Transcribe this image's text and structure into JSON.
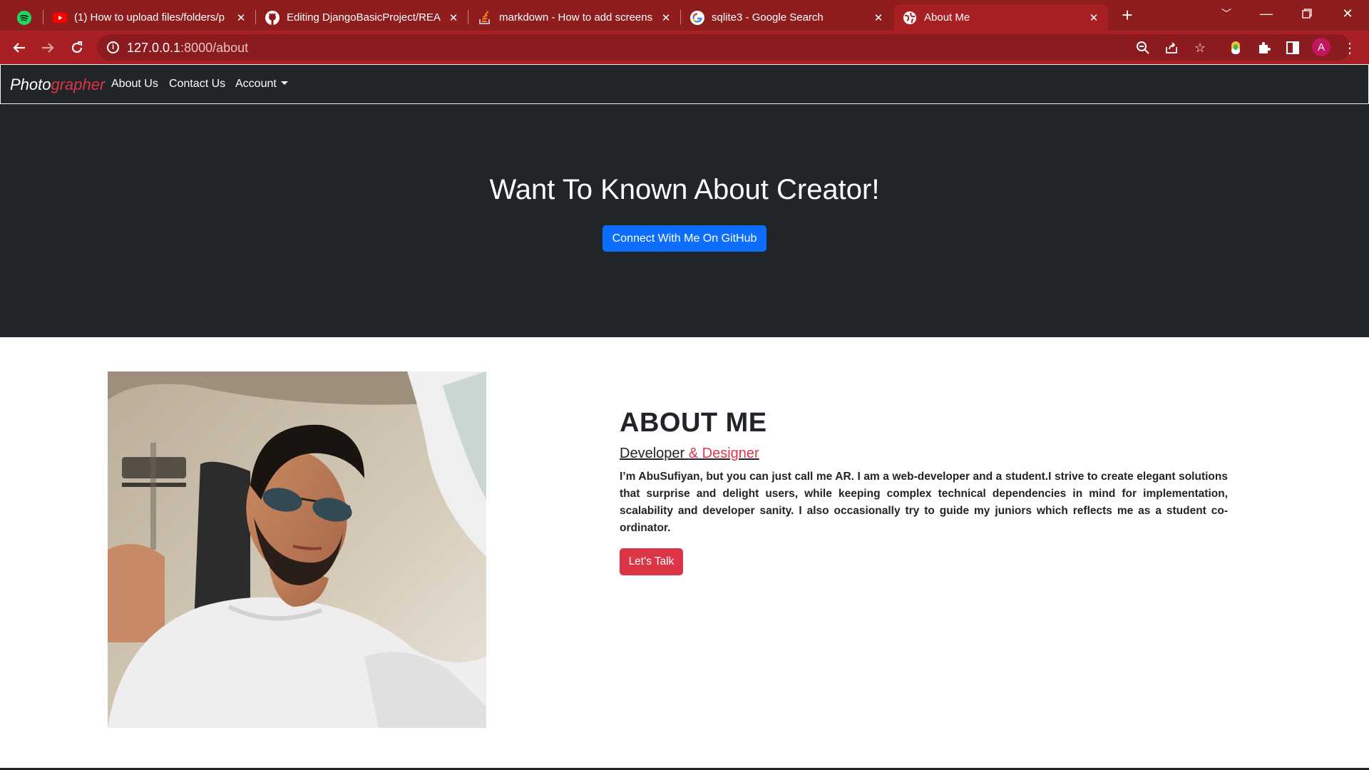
{
  "browser": {
    "tabs": [
      {
        "title": "",
        "icon": "spotify-icon"
      },
      {
        "title": "(1) How to upload files/folders/p",
        "icon": "youtube-icon"
      },
      {
        "title": "Editing DjangoBasicProject/READ",
        "icon": "github-icon"
      },
      {
        "title": "markdown - How to add screensl",
        "icon": "stackoverflow-icon"
      },
      {
        "title": "sqlite3 - Google Search",
        "icon": "google-icon"
      },
      {
        "title": "About Me",
        "icon": "globe-icon"
      }
    ],
    "url_host": "127.0.0.1",
    "url_path": ":8000/about",
    "profile_initial": "A",
    "theme_color": "#a81f24"
  },
  "navbar": {
    "brand_main": "Photo",
    "brand_accent": "grapher",
    "links": [
      "About Us",
      "Contact Us",
      "Account"
    ]
  },
  "hero": {
    "title": "Want To Known About Creator!",
    "button": "Connect With Me On GitHub"
  },
  "about": {
    "heading": "ABOUT ME",
    "role_primary": "Developer",
    "role_secondary": "& Designer",
    "bio": "I’m AbuSufiyan, but you can just call me AR. I am a web-developer and a student.I strive to create elegant solutions that surprise and delight users, while keeping complex technical dependencies in mind for implementation, scalability and developer sanity. I also occasionally try to guide my juniors which reflects me as a student co-ordinator.",
    "button": "Let's Talk"
  },
  "colors": {
    "primary_button": "#0d6efd",
    "danger": "#dc3545",
    "dark": "#212529"
  }
}
